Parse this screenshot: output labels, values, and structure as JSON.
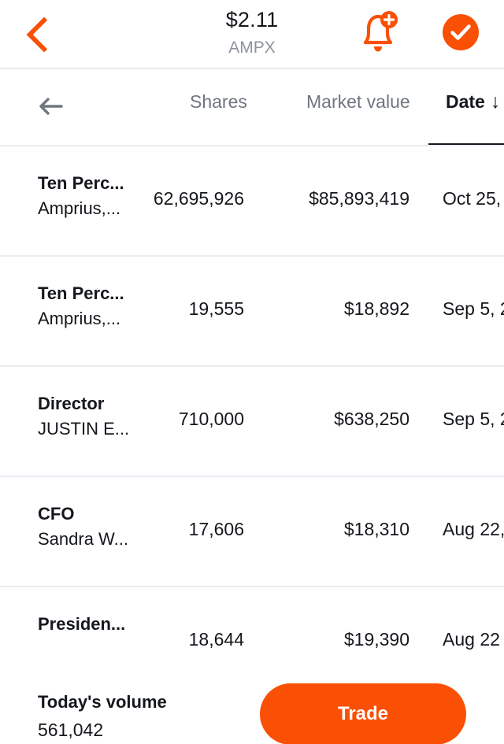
{
  "header": {
    "back_icon": "chevron-left-icon",
    "price": "$2.11",
    "ticker": "AMPX",
    "alert_icon": "bell-plus-icon",
    "watchlist_icon": "check-circle-filled-icon",
    "accent_color": "#fa5005"
  },
  "table": {
    "scroll_left_icon": "arrow-left-icon",
    "columns": [
      {
        "label": "Shares",
        "active": false
      },
      {
        "label": "Market value",
        "active": false
      },
      {
        "label": "Date",
        "active": true,
        "sort_arrow": "↓"
      }
    ],
    "rows": [
      {
        "role": "Ten Perc...",
        "name": "Amprius,...",
        "shares": "62,695,926",
        "market_value": "$85,893,419",
        "date": "Oct 25,"
      },
      {
        "role": "Ten Perc...",
        "name": "Amprius,...",
        "shares": "19,555",
        "market_value": "$18,892",
        "date": "Sep 5, 2"
      },
      {
        "role": "Director",
        "name": "JUSTIN E...",
        "shares": "710,000",
        "market_value": "$638,250",
        "date": "Sep 5, 2"
      },
      {
        "role": "CFO",
        "name": "Sandra W...",
        "shares": "17,606",
        "market_value": "$18,310",
        "date": "Aug 22,"
      },
      {
        "role": "Presiden...",
        "name": "",
        "shares": "18,644",
        "market_value": "$19,390",
        "date": "Aug 22"
      }
    ]
  },
  "footer": {
    "volume_label": "Today's volume",
    "volume_value": "561,042",
    "trade_label": "Trade"
  }
}
